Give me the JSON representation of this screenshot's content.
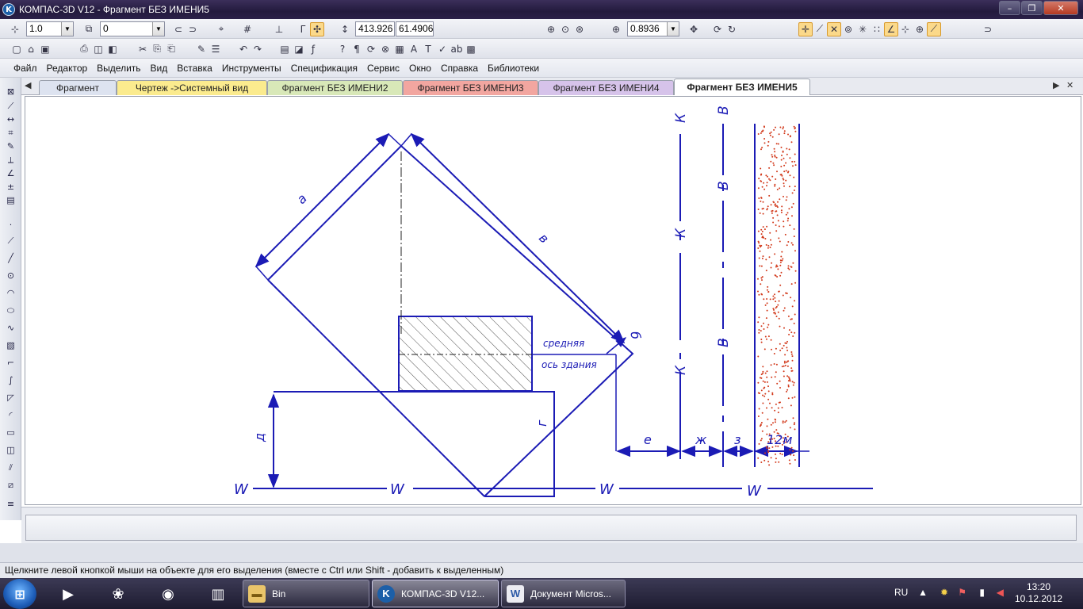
{
  "window": {
    "title": "КОМПАС-3D V12 - Фрагмент БЕЗ ИМЕНИ5",
    "logo_letter": "K",
    "minimize": "–",
    "maximize": "❐",
    "close": "✕"
  },
  "toolbar1": {
    "line_scale": "1.0",
    "layer": "0",
    "coord_x": "413.926",
    "coord_y": "61.4906",
    "zoom": "0.8936"
  },
  "menu": [
    "Файл",
    "Редактор",
    "Выделить",
    "Вид",
    "Вставка",
    "Инструменты",
    "Спецификация",
    "Сервис",
    "Окно",
    "Справка",
    "Библиотеки"
  ],
  "tabs": [
    {
      "label": "Фрагмент",
      "color": "#dde3f0"
    },
    {
      "label": "Чертеж ->Системный вид",
      "color": "#fbeb8e"
    },
    {
      "label": "Фрагмент БЕЗ ИМЕНИ2",
      "color": "#d8e8b8"
    },
    {
      "label": "Фрагмент БЕЗ ИМЕНИ3",
      "color": "#f2a6a0"
    },
    {
      "label": "Фрагмент БЕЗ ИМЕНИ4",
      "color": "#d6c3ea"
    },
    {
      "label": "Фрагмент БЕЗ ИМЕНИ5",
      "color": "#ffffff"
    }
  ],
  "drawing": {
    "label_a": "а",
    "label_v_diag": "в",
    "label_b": "б",
    "label_d": "д",
    "label_g": "г",
    "label_e": "е",
    "label_zh": "ж",
    "label_z": "з",
    "label_12m": "12м",
    "label_mid1": "средняя",
    "label_mid2": "ось здания",
    "axis_k": "К",
    "axis_v": "В",
    "axis_w": "W",
    "line_color": "#1b1bb5",
    "dot_color": "#d23a1c"
  },
  "status_text": "Щелкните левой кнопкой мыши на объекте для его выделения (вместе с Ctrl или Shift - добавить к выделенным)",
  "taskbar": {
    "start_glyph": "⊞",
    "tasks": [
      {
        "label": "Bin",
        "icon": "folder-icon"
      },
      {
        "label": "КОМПАС-3D V12...",
        "icon": "kompas-icon"
      },
      {
        "label": "Документ Micros...",
        "icon": "word-icon"
      }
    ],
    "lang": "RU",
    "time": "13:20",
    "date": "10.12.2012"
  }
}
